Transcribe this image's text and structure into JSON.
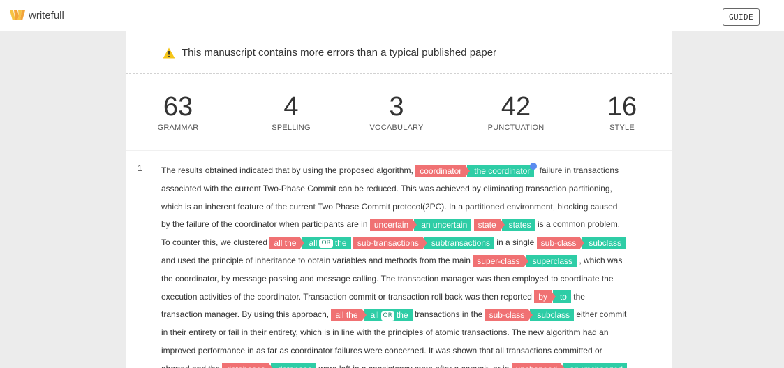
{
  "header": {
    "logo_text": "writefull",
    "guide_label": "GUIDE"
  },
  "warning": {
    "icon": "warning-icon",
    "text": "This manuscript contains more errors than a typical published paper"
  },
  "stats": [
    {
      "value": "63",
      "label": "GRAMMAR"
    },
    {
      "value": "4",
      "label": "SPELLING"
    },
    {
      "value": "3",
      "label": "VOCABULARY"
    },
    {
      "value": "42",
      "label": "PUNCTUATION"
    },
    {
      "value": "16",
      "label": "STYLE"
    }
  ],
  "paragraph": {
    "number": "1",
    "or_label": "OR",
    "lines": [
      [
        {
          "t": "text",
          "v": "The results obtained indicated that by using the proposed algorithm, "
        },
        {
          "t": "err",
          "v": "coordinator"
        },
        {
          "t": "fix",
          "v": "the coordinator"
        },
        {
          "t": "cursor"
        },
        {
          "t": "text",
          "v": " failure in transactions"
        }
      ],
      [
        {
          "t": "text",
          "v": "associated with the current Two-Phase Commit can be reduced. This was achieved by eliminating transaction partitioning,"
        }
      ],
      [
        {
          "t": "text",
          "v": "which is an inherent feature of the current Two Phase Commit protocol(2PC). In a partitioned environment, blocking caused"
        }
      ],
      [
        {
          "t": "text",
          "v": "by the failure of the coordinator when participants are in "
        },
        {
          "t": "err",
          "v": "uncertain"
        },
        {
          "t": "fix",
          "v": "an uncertain"
        },
        {
          "t": "text",
          "v": " "
        },
        {
          "t": "err",
          "v": "state"
        },
        {
          "t": "fix",
          "v": "states"
        },
        {
          "t": "text",
          "v": " is a common problem."
        }
      ],
      [
        {
          "t": "text",
          "v": "To counter this, we clustered "
        },
        {
          "t": "err",
          "v": "all the"
        },
        {
          "t": "fixor",
          "v1": "all",
          "v2": "the"
        },
        {
          "t": "text",
          "v": " "
        },
        {
          "t": "err",
          "v": "sub-transactions"
        },
        {
          "t": "fix",
          "v": "subtransactions"
        },
        {
          "t": "text",
          "v": " in a single "
        },
        {
          "t": "err",
          "v": "sub-class"
        },
        {
          "t": "fix",
          "v": "subclass"
        }
      ],
      [
        {
          "t": "text",
          "v": "and used the principle of inheritance to obtain variables and methods from the main "
        },
        {
          "t": "err",
          "v": "super-class"
        },
        {
          "t": "fix",
          "v": "superclass"
        },
        {
          "t": "text",
          "v": " , which was"
        }
      ],
      [
        {
          "t": "text",
          "v": "the coordinator, by message passing and message calling. The transaction manager was then employed to coordinate the"
        }
      ],
      [
        {
          "t": "text",
          "v": "execution activities of the coordinator. Transaction commit or transaction roll back was then reported "
        },
        {
          "t": "err",
          "v": "by"
        },
        {
          "t": "fix",
          "v": "to"
        },
        {
          "t": "text",
          "v": " the"
        }
      ],
      [
        {
          "t": "text",
          "v": "transaction manager. By using this approach, "
        },
        {
          "t": "err",
          "v": "all the"
        },
        {
          "t": "fixor",
          "v1": "all",
          "v2": "the"
        },
        {
          "t": "text",
          "v": " transactions in the "
        },
        {
          "t": "err",
          "v": "sub-class"
        },
        {
          "t": "fix",
          "v": "subclass"
        },
        {
          "t": "text",
          "v": " either commit"
        }
      ],
      [
        {
          "t": "text",
          "v": "in their entirety or fail in their entirety, which is in line with the principles of atomic transactions. The new algorithm had an"
        }
      ],
      [
        {
          "t": "text",
          "v": "improved performance in as far as coordinator failures were concerned. It was shown that all transactions committed or"
        }
      ],
      [
        {
          "t": "text",
          "v": "aborted and the "
        },
        {
          "t": "err",
          "v": "databases"
        },
        {
          "t": "fix",
          "v": "database"
        },
        {
          "t": "text",
          "v": " were left in a consistency state after a commit, or in "
        },
        {
          "t": "err",
          "v": "unchanged"
        },
        {
          "t": "fix",
          "v": "an unchanged"
        }
      ]
    ]
  },
  "colors": {
    "error": "#f07173",
    "fix": "#2ecda6",
    "warning": "#f5c518",
    "cursor": "#5b8cf0"
  }
}
